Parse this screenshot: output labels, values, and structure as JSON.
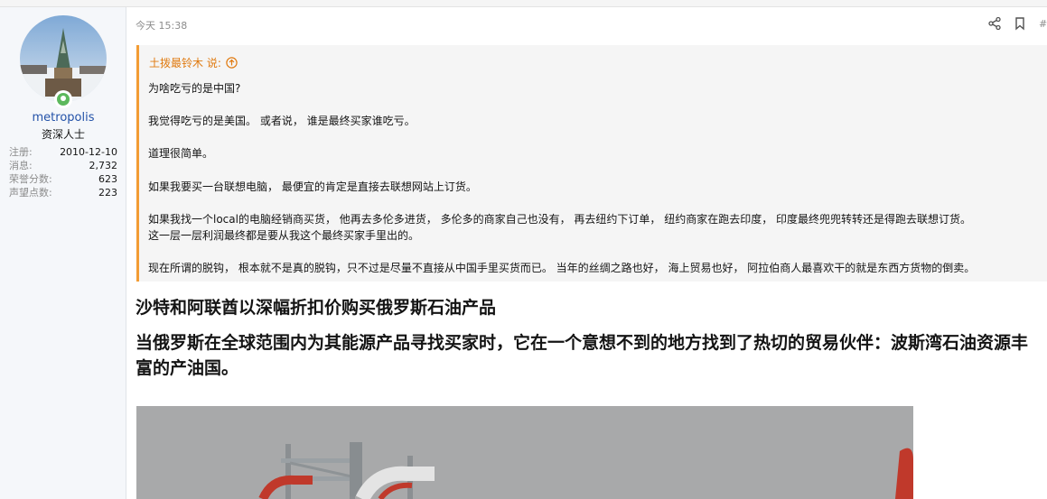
{
  "user": {
    "name": "metropolis",
    "title": "资深人士",
    "stats": [
      {
        "label": "注册:",
        "value": "2010-12-10"
      },
      {
        "label": "消息:",
        "value": "2,732"
      },
      {
        "label": "荣誉分数:",
        "value": "623"
      },
      {
        "label": "声望点数:",
        "value": "223"
      }
    ]
  },
  "post": {
    "time": "今天 15:38",
    "number": "#",
    "quote": {
      "author_said": "土拨最铃木 说:",
      "lines": [
        "为啥吃亏的是中国?",
        "我觉得吃亏的是美国。 或者说， 谁是最终买家谁吃亏。",
        "道理很简单。",
        "如果我要买一台联想电脑， 最便宜的肯定是直接去联想网站上订货。",
        "如果我找一个local的电脑经销商买货， 他再去多伦多进货， 多伦多的商家自己也没有， 再去纽约下订单， 纽约商家在跑去印度， 印度最终兜兜转转还是得跑去联想订货。",
        "这一层一层利润最终都是要从我这个最终买家手里出的。",
        "现在所谓的脱钩， 根本就不是真的脱钩，只不过是尽量不直接从中国手里买货而已。 当年的丝绸之路也好， 海上贸易也好， 阿拉伯商人最喜欢干的就是东西方货物的倒卖。"
      ]
    },
    "headline1": "沙特和阿联酋以深幅折扣价购买俄罗斯石油产品",
    "headline2": "当俄罗斯在全球范围内为其能源产品寻找买家时，它在一个意想不到的地方找到了热切的贸易伙伴：波斯湾石油资源丰富的产油国。"
  },
  "colors": {
    "accent": "#f39c34",
    "username": "#2352a8",
    "online": "#5cb85c"
  },
  "icons": [
    "share-icon",
    "bookmark-icon",
    "arrow-up-icon",
    "online-status-icon"
  ]
}
